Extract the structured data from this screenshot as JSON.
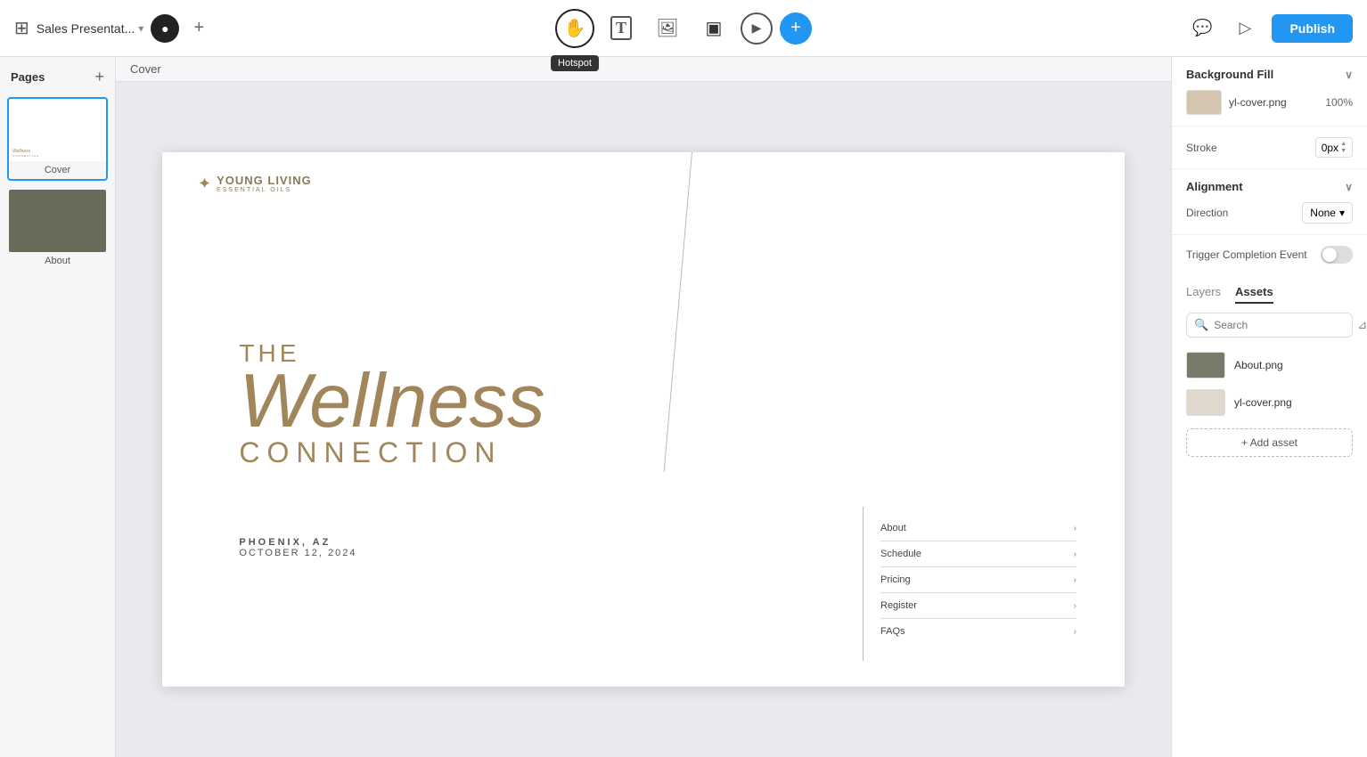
{
  "app": {
    "title": "Sales Presentat...",
    "title_chevron": "▾"
  },
  "toolbar": {
    "publish_label": "Publish",
    "hotspot_tooltip": "Hotspot",
    "tools": [
      {
        "id": "hotspot",
        "icon": "✋",
        "label": "Hotspot",
        "active": true
      },
      {
        "id": "text",
        "icon": "T",
        "label": "Text"
      },
      {
        "id": "image",
        "icon": "🖼",
        "label": "Image"
      },
      {
        "id": "transition",
        "icon": "⬜",
        "label": "Transition"
      },
      {
        "id": "play",
        "icon": "▷",
        "label": "Play"
      },
      {
        "id": "add",
        "icon": "+",
        "label": "Add"
      }
    ]
  },
  "pages": {
    "title": "Pages",
    "add_label": "+",
    "items": [
      {
        "id": "cover",
        "label": "Cover",
        "active": true
      },
      {
        "id": "about",
        "label": "About"
      }
    ]
  },
  "breadcrumb": {
    "text": "Cover"
  },
  "slide": {
    "brand": "YOUNG LIVING",
    "brand_sub": "ESSENTIAL OILS",
    "title_the": "THE",
    "title_main": "Wellness",
    "title_sub": "CONNECTION",
    "city": "PHOENIX, AZ",
    "date": "OCTOBER 12, 2024",
    "menu": [
      {
        "label": "About",
        "arrow": "›"
      },
      {
        "label": "Schedule",
        "arrow": "›"
      },
      {
        "label": "Pricing",
        "arrow": "›"
      },
      {
        "label": "Register",
        "arrow": "›"
      },
      {
        "label": "FAQs",
        "arrow": "›"
      }
    ]
  },
  "right_panel": {
    "background_section": {
      "title": "Background Fill",
      "bg_file": "yl-cover.png",
      "bg_opacity": "100%"
    },
    "stroke_section": {
      "label": "Stroke",
      "value": "0px"
    },
    "alignment_section": {
      "title": "Alignment",
      "direction_label": "Direction",
      "direction_value": "None"
    },
    "trigger_section": {
      "label": "Trigger Completion Event",
      "enabled": false
    },
    "tabs": {
      "layers": "Layers",
      "assets": "Assets"
    },
    "search_placeholder": "Search",
    "assets": [
      {
        "id": "about",
        "name": "About.png"
      },
      {
        "id": "yl-cover",
        "name": "yl-cover.png"
      }
    ],
    "add_asset_label": "+ Add asset"
  }
}
